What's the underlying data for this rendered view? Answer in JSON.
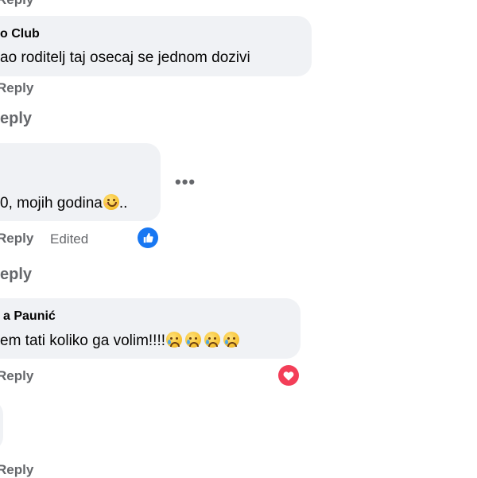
{
  "top": {
    "reply_label": "Reply"
  },
  "comment1": {
    "author": "o Club",
    "text": "ao roditelj taj osecaj se jednom dozivi",
    "reply_label": "Reply"
  },
  "view_replies_1": "eply",
  "comment2": {
    "text": "0, mojih godina",
    "text_suffix": "..",
    "emoji": "smiling-face-icon",
    "reply_label": "Reply",
    "edited_label": "Edited",
    "reaction": "like-icon",
    "more_label": "•••"
  },
  "view_replies_2": "eply",
  "comment3": {
    "author": "a Paunić",
    "text": "em tati koliko ga volim!!!!",
    "emojis": [
      "crying-face-icon",
      "crying-face-icon",
      "crying-face-icon",
      "crying-face-icon"
    ],
    "reply_label": "Reply",
    "reaction": "heart-icon"
  },
  "comment4": {
    "reply_label": "Reply"
  },
  "colors": {
    "bubble": "#f0f2f5",
    "meta": "#65676b",
    "like": "#1877f2",
    "love": "#f33e58"
  }
}
